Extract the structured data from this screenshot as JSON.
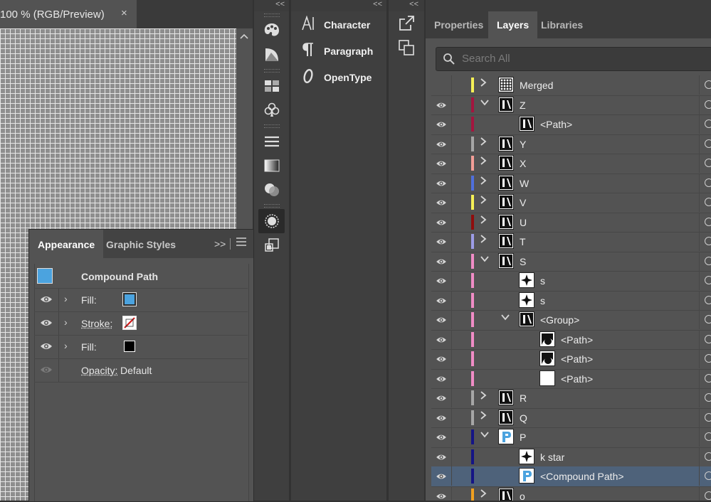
{
  "document": {
    "title": "100 % (RGB/Preview)",
    "close_glyph": "×"
  },
  "collapse_glyph": "<<",
  "appearance_panel": {
    "tabs": [
      "Appearance",
      "Graphic Styles"
    ],
    "more_glyph": ">>",
    "object_type": "Compound Path",
    "object_swatch_color": "#4ba3df",
    "rows": [
      {
        "label": "Fill:",
        "swatch": "#4ba3df",
        "type": "fill"
      },
      {
        "label": "Stroke:",
        "swatch": "none",
        "type": "stroke"
      },
      {
        "label": "Fill:",
        "swatch": "#000000",
        "type": "fill"
      }
    ],
    "opacity_label": "Opacity:",
    "opacity_value": "Default"
  },
  "type_panels": {
    "items": [
      {
        "label": "Character",
        "icon": "character-icon"
      },
      {
        "label": "Paragraph",
        "icon": "paragraph-icon"
      },
      {
        "label": "OpenType",
        "icon": "opentype-icon"
      }
    ]
  },
  "layers_panel": {
    "tabs": [
      "Properties",
      "Layers",
      "Libraries"
    ],
    "active_tab": "Layers",
    "search_placeholder": "Search All",
    "rows": [
      {
        "label": "Merged",
        "color": "#f5f056",
        "level": 0,
        "chevron": "›",
        "visible": false,
        "thumb": "grid"
      },
      {
        "label": "Z",
        "color": "#a3163f",
        "level": 0,
        "chevron": "⌄",
        "visible": true,
        "thumb": "glyph"
      },
      {
        "label": "<Path>",
        "color": "#a3163f",
        "level": 1,
        "chevron": "",
        "visible": true,
        "thumb": "glyph"
      },
      {
        "label": "Y",
        "color": "#a6a6a6",
        "level": 0,
        "chevron": "›",
        "visible": true,
        "thumb": "glyph"
      },
      {
        "label": "X",
        "color": "#f29e97",
        "level": 0,
        "chevron": "›",
        "visible": true,
        "thumb": "glyph"
      },
      {
        "label": "W",
        "color": "#4f6fdc",
        "level": 0,
        "chevron": "›",
        "visible": true,
        "thumb": "glyph"
      },
      {
        "label": "V",
        "color": "#f5f056",
        "level": 0,
        "chevron": "›",
        "visible": true,
        "thumb": "glyph"
      },
      {
        "label": "U",
        "color": "#8f0d0d",
        "level": 0,
        "chevron": "›",
        "visible": true,
        "thumb": "glyph"
      },
      {
        "label": "T",
        "color": "#9c9ce6",
        "level": 0,
        "chevron": "›",
        "visible": true,
        "thumb": "glyph"
      },
      {
        "label": "S",
        "color": "#f08cc6",
        "level": 0,
        "chevron": "⌄",
        "visible": true,
        "thumb": "glyph"
      },
      {
        "label": "s",
        "color": "#f08cc6",
        "level": 1,
        "chevron": "",
        "visible": true,
        "thumb": "star"
      },
      {
        "label": "s",
        "color": "#f08cc6",
        "level": 1,
        "chevron": "",
        "visible": true,
        "thumb": "star"
      },
      {
        "label": "<Group>",
        "color": "#f08cc6",
        "level": 1,
        "chevron": "⌄",
        "visible": true,
        "thumb": "glyph"
      },
      {
        "label": "<Path>",
        "color": "#f08cc6",
        "level": 2,
        "chevron": "",
        "visible": true,
        "thumb": "shape"
      },
      {
        "label": "<Path>",
        "color": "#f08cc6",
        "level": 2,
        "chevron": "",
        "visible": true,
        "thumb": "shape"
      },
      {
        "label": "<Path>",
        "color": "#f08cc6",
        "level": 2,
        "chevron": "",
        "visible": true,
        "thumb": "blank"
      },
      {
        "label": "R",
        "color": "#a6a6a6",
        "level": 0,
        "chevron": "›",
        "visible": true,
        "thumb": "glyph"
      },
      {
        "label": "Q",
        "color": "#a6a6a6",
        "level": 0,
        "chevron": "›",
        "visible": true,
        "thumb": "glyph"
      },
      {
        "label": "P",
        "color": "#151585",
        "level": 0,
        "chevron": "⌄",
        "visible": true,
        "thumb": "blue"
      },
      {
        "label": "k star",
        "color": "#151585",
        "level": 1,
        "chevron": "",
        "visible": true,
        "thumb": "star"
      },
      {
        "label": "<Compound Path>",
        "color": "#151585",
        "level": 1,
        "chevron": "",
        "visible": true,
        "thumb": "blue",
        "selected": true
      },
      {
        "label": "o",
        "color": "#f0a020",
        "level": 0,
        "chevron": "›",
        "visible": true,
        "thumb": "glyph"
      }
    ]
  }
}
